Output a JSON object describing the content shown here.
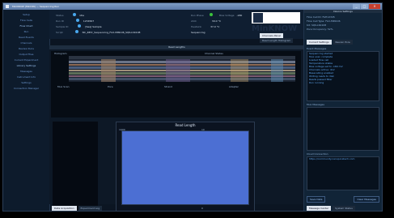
{
  "window": {
    "title": "MinKNOW (MinION) — Sequencing Run",
    "buttons": [
      "_",
      "□",
      "×"
    ]
  },
  "sidebar": {
    "items": [
      {
        "label": "Setup"
      },
      {
        "label": "Flow Cells"
      },
      {
        "label": "Flow Chart"
      },
      {
        "label": "Run"
      },
      {
        "label": "Read Events"
      },
      {
        "label": "Channels"
      },
      {
        "label": "Review Runs"
      },
      {
        "label": "Output Files"
      },
      {
        "label": "Current Experiment"
      },
      {
        "label": "Library Settings"
      },
      {
        "label": "Messages"
      },
      {
        "label": "Instrument Info"
      },
      {
        "label": "Settings"
      },
      {
        "label": "Connection Manager"
      }
    ]
  },
  "header": {
    "status_label": "Status",
    "status_value": "Idle",
    "run_id_label": "Run ID",
    "run_id_value": "1234567",
    "sample_label": "Sample ID",
    "sample_value": "[Seq] Sample",
    "script_label": "Script",
    "script_value": "NC_48Hr_Sequencing_FLO-MIN106_SQK-LSK108",
    "run_phase_label": "Run Phase",
    "run_phase_value": "Sequencing",
    "asic_label": "ASIC",
    "asic_value": "30.0 °C",
    "heatsink_label": "Heatsink",
    "heatsink_value": "37.0 °C",
    "bias_label": "Bias Voltage",
    "bias_value": "-180",
    "logo_text": "MinKNOW",
    "tabs": [
      "Channels Panel",
      "Read Length Histogram"
    ]
  },
  "main": {
    "panel_title": "Read Lengths",
    "heat_title": "Histogram",
    "heat_right_title": "Channel States",
    "x_labels": [
      "Mux Scan",
      "Pore",
      "Strand",
      "Adapter"
    ],
    "read_title": "Read Length",
    "read_axis_left": "1000",
    "read_axis_top": "10",
    "read_axis_bottom": "0",
    "bottom_tabs": [
      "Data Acquisition",
      "Experiment Log"
    ]
  },
  "right": {
    "title": "Device Settings",
    "lines": [
      "Flow Cell ID: FAH12345",
      "Flow Cell Type: FLO-MIN106",
      "Kit: SQK-LSK108",
      "Pore Occupancy: 52%"
    ],
    "tabs": [
      "Current Settings",
      "Rescan Pore"
    ],
    "messages_label": "Event Messages",
    "messages": [
      "Sequencing started",
      "Mux scan complete",
      "Loaded flow cell",
      "Temperature stable",
      "Bias voltage set to -180 mV",
      "Channels active: 412",
      "Basecalling enabled",
      "Writing reads to disk",
      "Reads passed filter",
      "Run running"
    ],
    "status_label": "Mux Messages",
    "notice_label": "Cloud Connection",
    "notice_text": "https://community.nanoporetech.com",
    "buttons": [
      "Save Data",
      "Clear Messages"
    ],
    "bottom_tabs": [
      "Message Center",
      "System Status"
    ]
  },
  "colors": {
    "plot_fill": "#4c6fd3",
    "accent": "#4aa8ee",
    "status_green": "#3cc23c"
  }
}
